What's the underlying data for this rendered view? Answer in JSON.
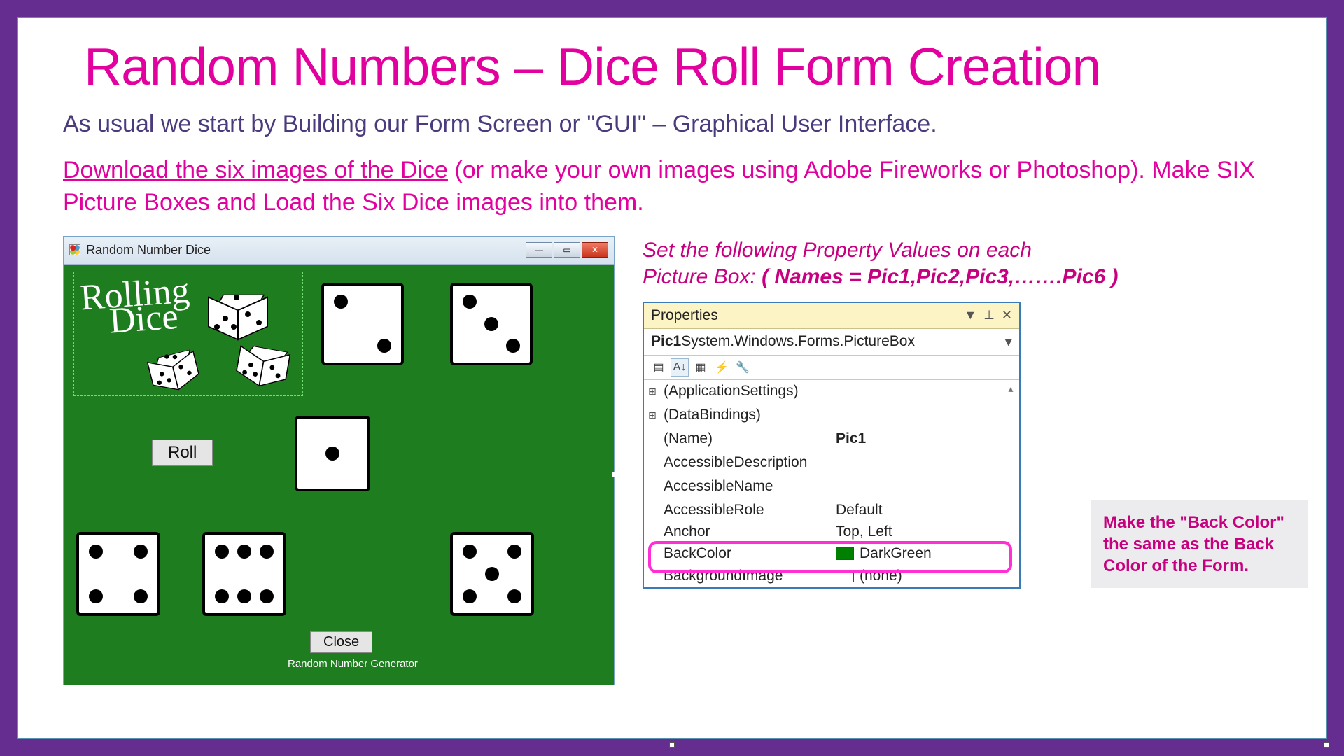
{
  "title": "Random Numbers – Dice Roll Form Creation",
  "intro": "As usual we start by Building our Form Screen or \"GUI\" – Graphical User Interface.",
  "download_link": "Download the six images of the Dice",
  "instr_rest": " (or make your own images using Adobe Fireworks or Photoshop). Make SIX Picture Boxes and Load the Six Dice images into them.",
  "winform": {
    "title": "Random Number Dice",
    "logo_line1": "Rolling",
    "logo_line2": "Dice",
    "roll_label": "Roll",
    "close_label": "Close",
    "footer_label": "Random Number Generator"
  },
  "right": {
    "set_line1": "Set the following Property Values on each",
    "set_line2_a": "Picture Box:  ",
    "set_line2_b": "( Names = Pic1,Pic2,Pic3,…….Pic6 )"
  },
  "props": {
    "header": "Properties",
    "subheader_name": "Pic1",
    "subheader_type": " System.Windows.Forms.PictureBox",
    "rows": {
      "app": "(ApplicationSettings)",
      "databind": "(DataBindings)",
      "name_lbl": "(Name)",
      "name_val": "Pic1",
      "accdesc": "AccessibleDescription",
      "accname": "AccessibleName",
      "accrole_lbl": "AccessibleRole",
      "accrole_val": "Default",
      "anchor_lbl": "Anchor",
      "anchor_val": "Top, Left",
      "backcolor_lbl": "BackColor",
      "backcolor_val": "DarkGreen",
      "bgimg_lbl": "BackgroundImage",
      "bgimg_val": "(none)"
    }
  },
  "callout": "Make the \"Back Color\" the same as the Back Color of the Form."
}
